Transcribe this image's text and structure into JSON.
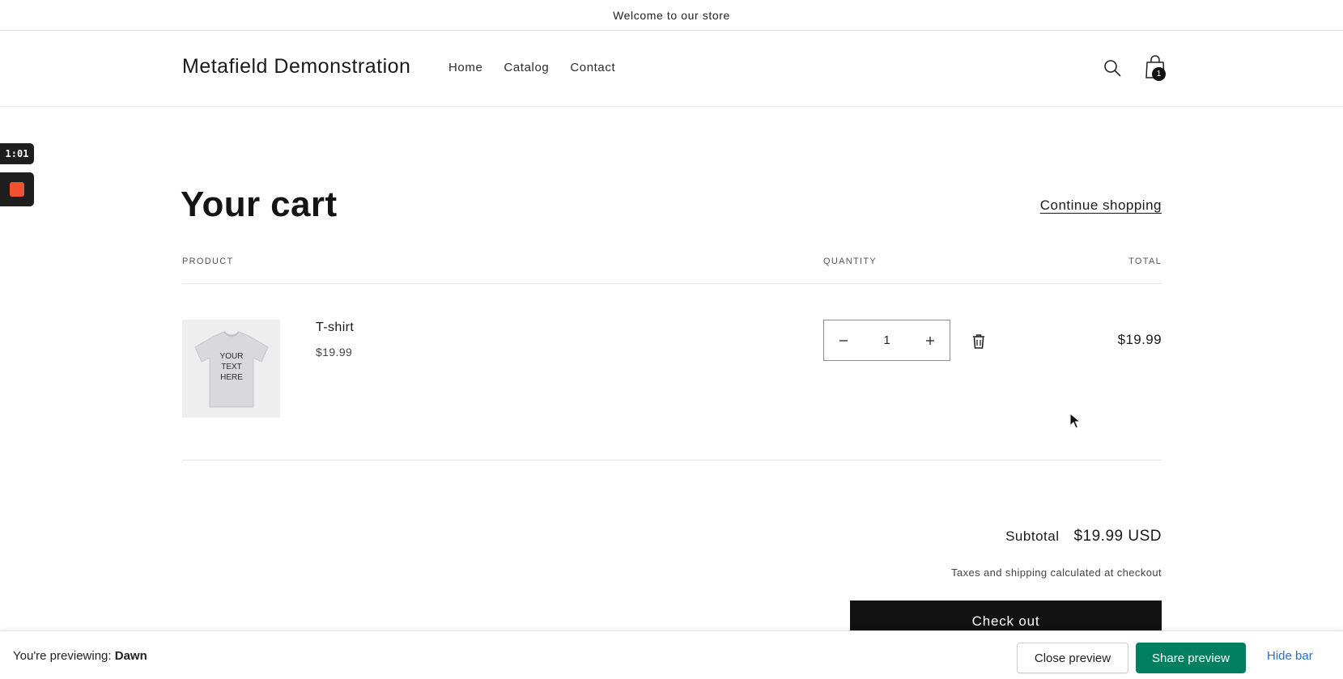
{
  "announcement": "Welcome to our store",
  "header": {
    "logo": "Metafield Demonstration",
    "nav": [
      "Home",
      "Catalog",
      "Contact"
    ],
    "cart_count": "1"
  },
  "recorder": {
    "timer": "1:01"
  },
  "cart": {
    "title": "Your cart",
    "continue_label": "Continue shopping",
    "columns": {
      "product": "PRODUCT",
      "quantity": "QUANTITY",
      "total": "TOTAL"
    },
    "items": [
      {
        "image_text": [
          "YOUR",
          "TEXT",
          "HERE"
        ],
        "name": "T-shirt",
        "price": "$19.99",
        "quantity": "1",
        "line_total": "$19.99"
      }
    ],
    "subtotal_label": "Subtotal",
    "subtotal_value": "$19.99 USD",
    "tax_note": "Taxes and shipping calculated at checkout",
    "checkout_label": "Check out"
  },
  "preview_bar": {
    "previewing_label": "You're previewing:",
    "theme_name": "Dawn",
    "close_label": "Close preview",
    "share_label": "Share preview",
    "hide_label": "Hide bar",
    "share_color": "#008060"
  }
}
